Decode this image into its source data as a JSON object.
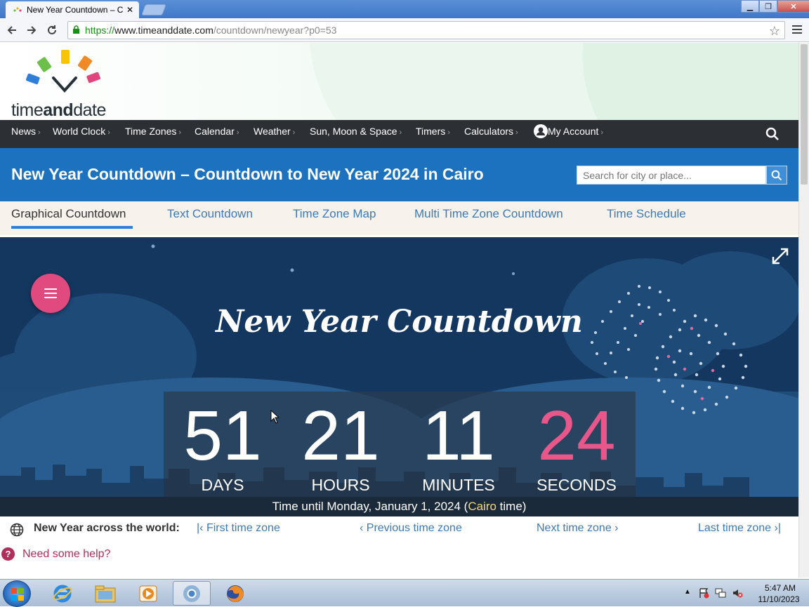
{
  "browser": {
    "tab_title": "New Year Countdown – C",
    "tab_close": "✕",
    "url_https": "https://",
    "url_host": "www.timeanddate.com",
    "url_path": "/countdown/newyear?p0=53",
    "window_min": "▁",
    "window_max": "❐",
    "window_close": "✕"
  },
  "logo": {
    "text_time": "time",
    "text_and": "and",
    "text_date": "date"
  },
  "nav": {
    "items": [
      {
        "label": "News"
      },
      {
        "label": "World Clock"
      },
      {
        "label": "Time Zones"
      },
      {
        "label": "Calendar"
      },
      {
        "label": "Weather"
      },
      {
        "label": "Sun, Moon & Space"
      },
      {
        "label": "Timers"
      },
      {
        "label": "Calculators"
      },
      {
        "label": "My Account"
      }
    ],
    "chevron": "›"
  },
  "page": {
    "title": "New Year Countdown – Countdown to New Year 2024 in Cairo",
    "search_placeholder": "Search for city or place..."
  },
  "subtabs": [
    {
      "label": "Graphical Countdown",
      "active": true
    },
    {
      "label": "Text Countdown"
    },
    {
      "label": "Time Zone Map"
    },
    {
      "label": "Multi Time Zone Countdown"
    },
    {
      "label": "Time Schedule"
    }
  ],
  "countdown": {
    "title": "New Year Countdown",
    "days": "51",
    "days_label": "DAYS",
    "hours": "21",
    "hours_label": "HOURS",
    "minutes": "11",
    "minutes_label": "MINUTES",
    "seconds": "24",
    "seconds_label": "SECONDS",
    "footer_prefix": "Time until Monday, January 1, 2024 (",
    "footer_city": "Cairo",
    "footer_suffix": " time)",
    "accent_color": "#e8568a"
  },
  "world": {
    "label": "New Year across the world:",
    "first": "First time zone",
    "previous": "Previous time zone",
    "next": "Next time zone",
    "last": "Last time zone"
  },
  "help": {
    "icon": "?",
    "text": "Need some help?"
  },
  "taskbar": {
    "time": "5:47 AM",
    "date": "11/10/2023"
  }
}
